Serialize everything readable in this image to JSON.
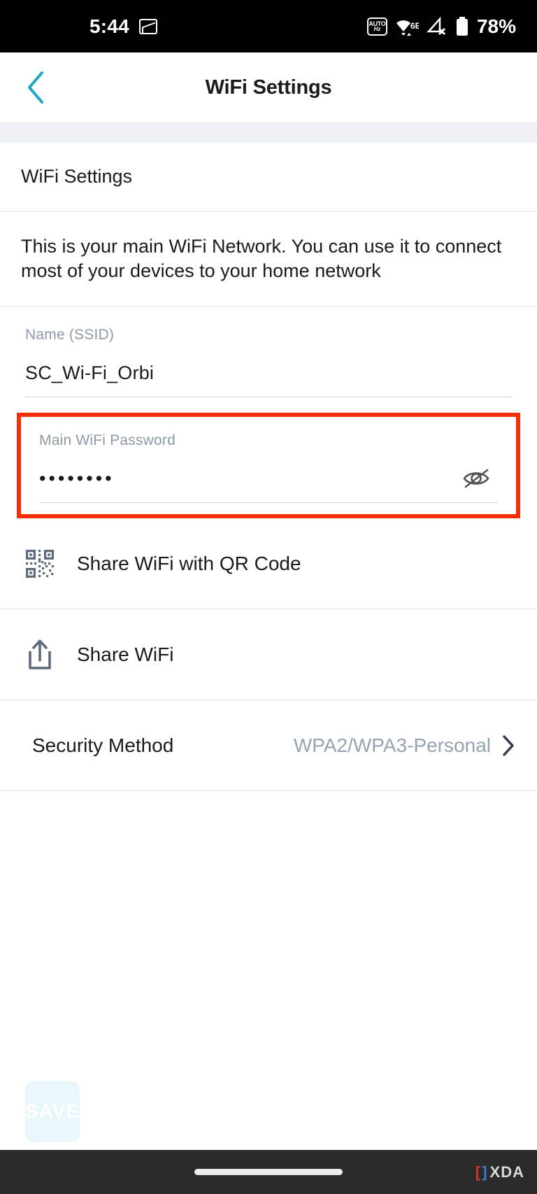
{
  "statusbar": {
    "time": "5:44",
    "battery_text": "78%",
    "icons": [
      "screenshot-icon",
      "auto-hz-icon",
      "wifi-6e-icon",
      "no-sim-icon",
      "battery-icon"
    ],
    "wifi_label": "6E"
  },
  "appbar": {
    "title": "WiFi Settings",
    "back_icon": "chevron-left-icon",
    "accent": "#1aa7c6"
  },
  "section": {
    "title": "WiFi Settings",
    "description": "This is your main WiFi Network. You can use it to connect most of your devices to your home network"
  },
  "fields": {
    "ssid": {
      "label": "Name (SSID)",
      "value": "SC_Wi-Fi_Orbi",
      "placeholder": "Name (SSID)"
    },
    "password": {
      "label": "Main WiFi Password",
      "value": "••••••••",
      "placeholder": "Main WiFi Password",
      "toggle_icon": "eye-off-icon",
      "highlight_color": "#f42e08"
    }
  },
  "rows": [
    {
      "label": "Share WiFi with QR Code",
      "icon": "qr-code-icon"
    },
    {
      "label": "Share WiFi",
      "icon": "share-icon"
    }
  ],
  "security": {
    "label": "Security Method",
    "value": "WPA2/WPA3-Personal",
    "chevron_icon": "chevron-right-icon"
  },
  "save": {
    "label": "SAVE",
    "enabled": false,
    "background": "#e9f6fb"
  },
  "navbar": {
    "gesture_pill": "home-indicator",
    "watermark": "XDA"
  }
}
